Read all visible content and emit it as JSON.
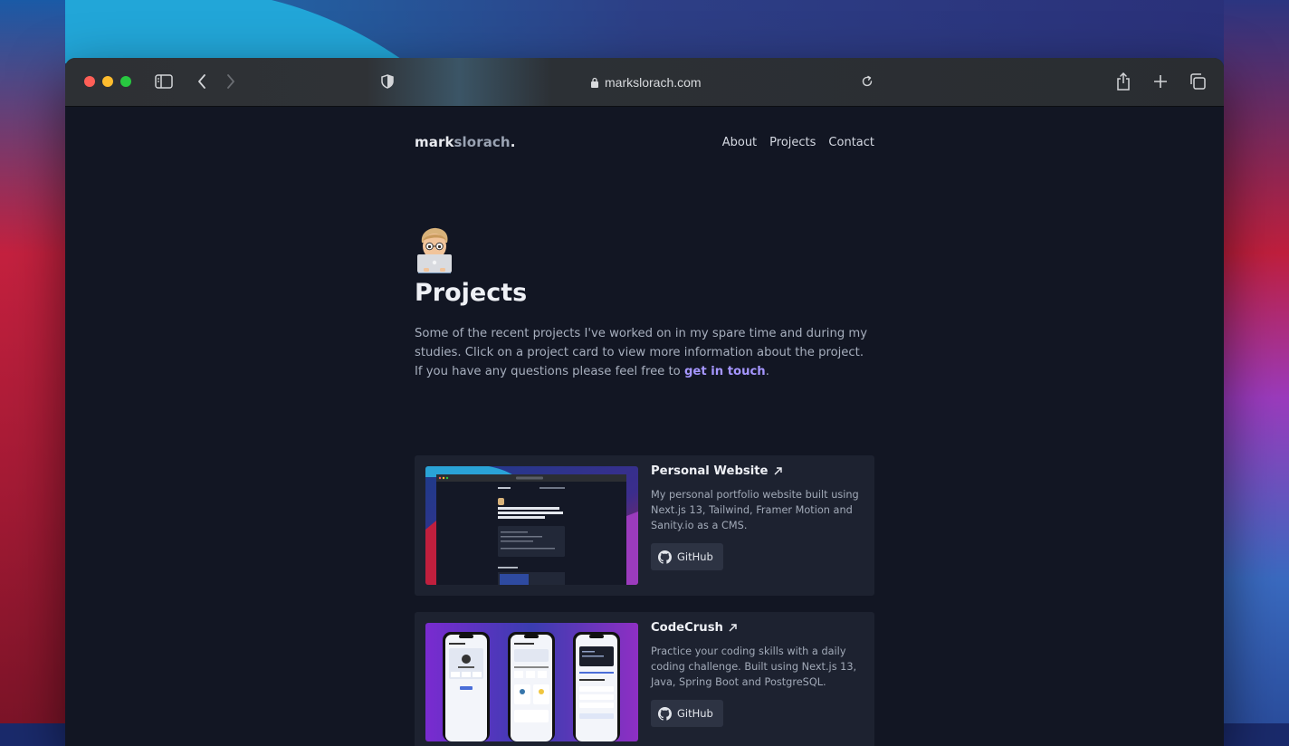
{
  "browser": {
    "url": "markslorach.com"
  },
  "site": {
    "logo_bold": "mark",
    "logo_light": "slorach",
    "logo_dot": ".",
    "nav": [
      "About",
      "Projects",
      "Contact"
    ]
  },
  "page": {
    "title": "Projects",
    "intro_text": "Some of the recent projects I've worked on in my spare time and during my studies. Click on a project card to view more information about the project. If you have any questions please feel free to ",
    "intro_link": "get in touch",
    "intro_end": "."
  },
  "projects": [
    {
      "name": "Personal Website",
      "description": "My personal portfolio website built using Next.js 13, Tailwind, Framer Motion and Sanity.io as a CMS.",
      "button": "GitHub"
    },
    {
      "name": "CodeCrush",
      "description": "Practice your coding skills with a daily coding challenge. Built using Next.js 13, Java, Spring Boot and PostgreSQL.",
      "button": "GitHub"
    }
  ],
  "colors": {
    "page_bg": "#121623",
    "card_bg": "#1d2230",
    "accent_link": "#a596ff"
  }
}
